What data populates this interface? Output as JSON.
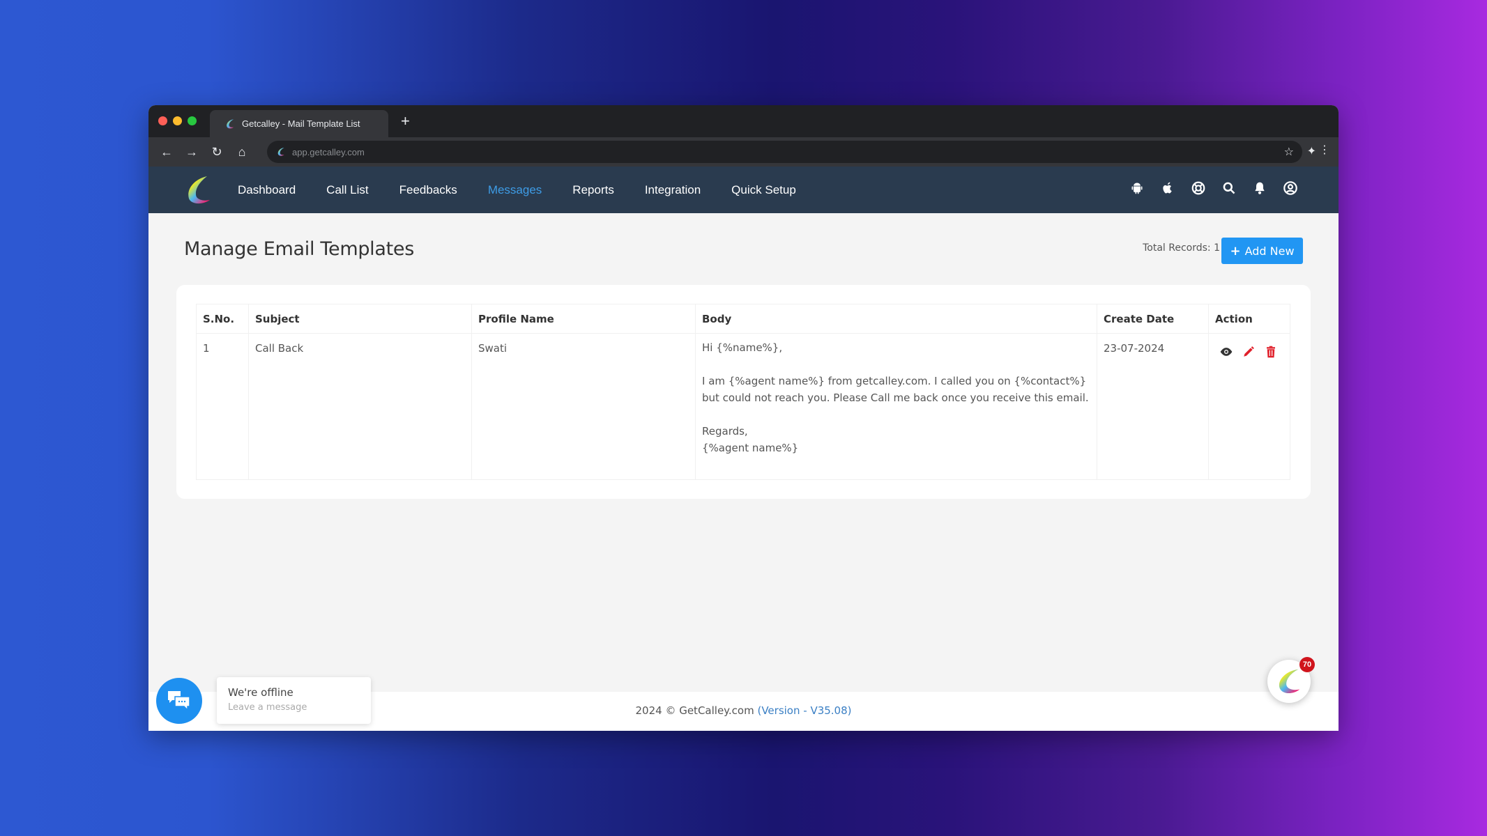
{
  "browser": {
    "tab_title": "Getcalley - Mail Template List",
    "new_tab": "+",
    "url": "app.getcalley.com",
    "icons": [
      "back-arrow-icon",
      "forward-arrow-icon",
      "reload-icon",
      "home-icon",
      "star-icon",
      "extensions-icon",
      "more-icon"
    ]
  },
  "nav": {
    "items": [
      {
        "label": "Dashboard",
        "active": false
      },
      {
        "label": "Call List",
        "active": false
      },
      {
        "label": "Feedbacks",
        "active": false
      },
      {
        "label": "Messages",
        "active": true
      },
      {
        "label": "Reports",
        "active": false
      },
      {
        "label": "Integration",
        "active": false
      },
      {
        "label": "Quick Setup",
        "active": false
      }
    ],
    "icons": [
      "android-icon",
      "apple-icon",
      "support-icon",
      "search-icon",
      "bell-icon",
      "user-icon"
    ]
  },
  "page": {
    "title": "Manage Email Templates",
    "total_records": "Total Records: 1",
    "add_button": "Add New"
  },
  "table": {
    "headers": [
      "S.No.",
      "Subject",
      "Profile Name",
      "Body",
      "Create Date",
      "Action"
    ],
    "rows": [
      {
        "sno": "1",
        "subject": "Call Back",
        "profile": "Swati",
        "body": "Hi {%name%},\n\nI am {%agent name%} from getcalley.com. I called you on {%contact%} but could not reach you. Please Call me back once you receive this email.\n\nRegards,\n{%agent name%}",
        "date": "23-07-2024",
        "actions": [
          "view-icon",
          "edit-icon",
          "delete-icon"
        ]
      }
    ]
  },
  "footer": {
    "copyright": "2024 © GetCalley.com ",
    "version": "(Version - V35.08)"
  },
  "chat": {
    "title": "We're offline",
    "subtitle": "Leave a message"
  },
  "floating": {
    "badge": "70"
  },
  "colors": {
    "nav_bg": "#2a3b4f",
    "active_nav": "#3e9ce6",
    "primary": "#2196f3",
    "danger": "#e0202b"
  }
}
